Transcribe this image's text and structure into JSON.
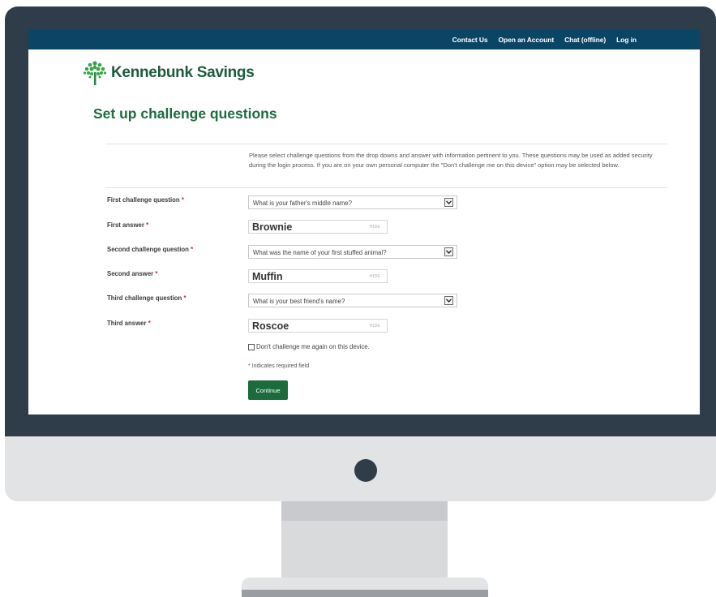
{
  "topnav": {
    "items": [
      "Contact Us",
      "Open an Account",
      "Chat (offline)",
      "Log in"
    ]
  },
  "brand": {
    "name": "Kennebunk Savings",
    "logo_icon": "tree-icon",
    "color": "#1d6b3e"
  },
  "page": {
    "title": "Set up challenge questions",
    "intro": "Please select challenge questions from the drop downs and answer with information pertinent to you.  These questions may be used as added security during the login process.  If you are on your own personal computer the \"Don't challenge me on this device\" option may be selected below."
  },
  "form": {
    "q1_label": "First challenge question",
    "q1_value": "What is your father's middle name?",
    "a1_label": "First answer",
    "a1_value": "Brownie",
    "q2_label": "Second challenge question",
    "q2_value": "What was the name of your first stuffed animal?",
    "a2_label": "Second answer",
    "a2_value": "Muffin",
    "q3_label": "Third challenge question",
    "q3_value": "What is your best friend's name?",
    "a3_label": "Third answer",
    "a3_value": "Roscoe",
    "hide_label": "HIDE",
    "required_mark": "*",
    "dont_challenge_label": "Don't challenge me again on this device.",
    "required_note": "Indicates required field",
    "continue_label": "Continue"
  },
  "colors": {
    "topbar": "#0b4565",
    "button": "#1c6b3c",
    "required": "#d2232a"
  }
}
